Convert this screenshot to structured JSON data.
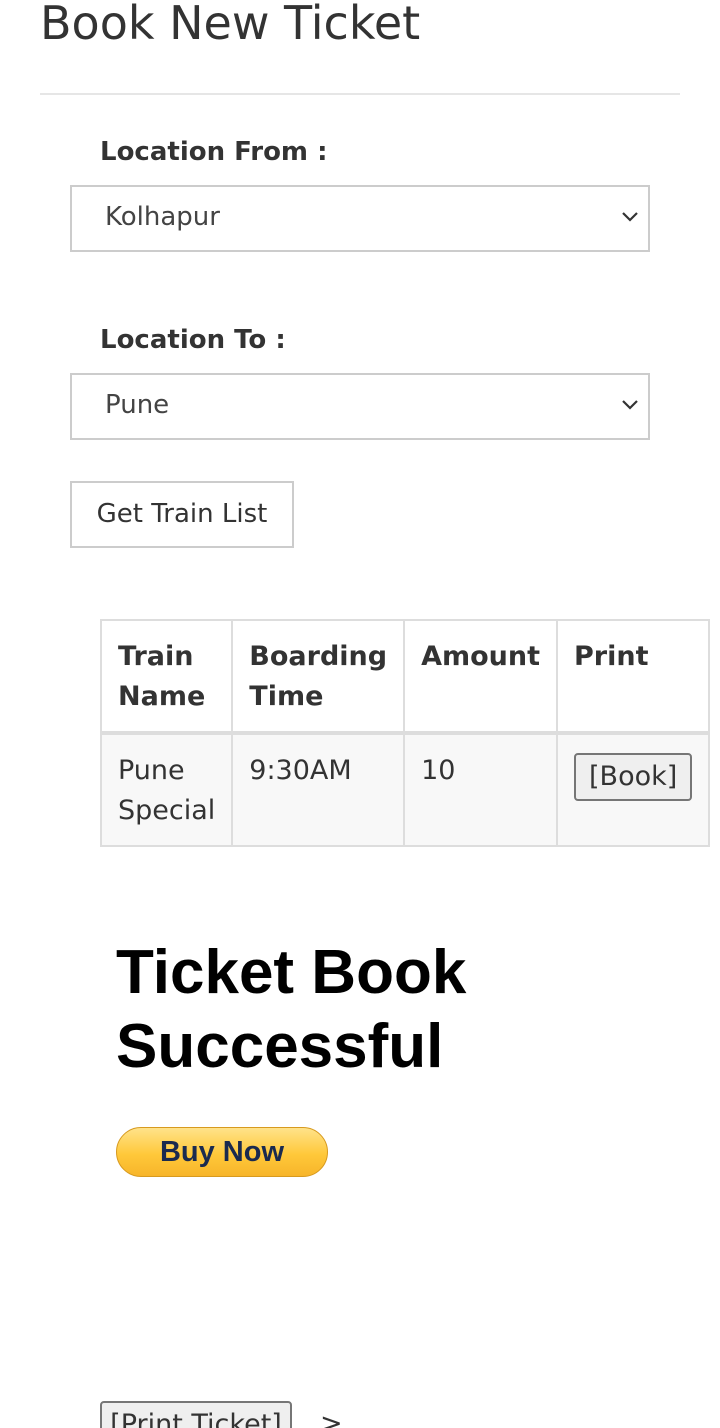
{
  "page": {
    "title": "Book New Ticket"
  },
  "form": {
    "from_label": "Location From :",
    "from_value": "Kolhapur",
    "to_label": "Location To :",
    "to_value": "Pune",
    "get_train_list_label": "Get Train List",
    "select_icon": "chevron-down-icon"
  },
  "table": {
    "headers": [
      "Train Name",
      "Boarding Time",
      "Amount",
      "Print"
    ],
    "rows": [
      {
        "train_name": "Pune Special",
        "boarding_time": "9:30AM",
        "amount": "10",
        "action_label": "[Book]"
      }
    ]
  },
  "result": {
    "message": "Ticket Book Successful",
    "buy_now_label": "Buy Now",
    "print_ticket_label": "[Print Ticket]",
    "trailing_text": ">"
  },
  "colors": {
    "text": "#333333",
    "border": "#cccccc",
    "table_border": "#dddddd",
    "row_background": "#f8f8f8",
    "buy_now_gold": "#ffc83a",
    "buy_now_text": "#1a2a4f"
  }
}
